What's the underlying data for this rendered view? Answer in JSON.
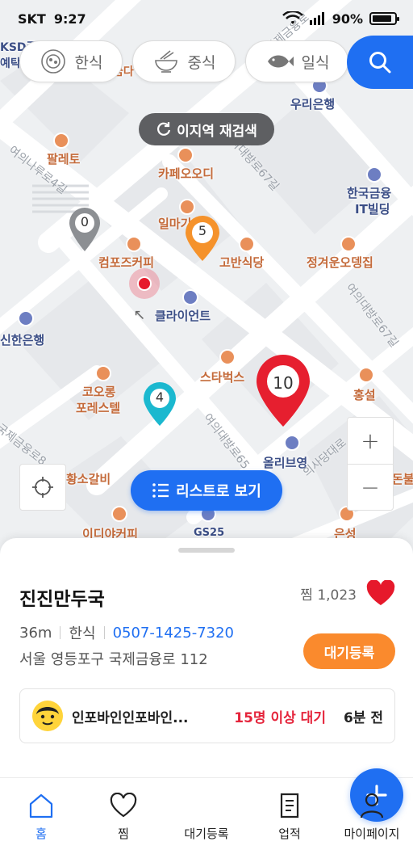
{
  "status_bar": {
    "carrier": "SKT",
    "time": "9:27",
    "battery": "90%",
    "battery_level": 0.9
  },
  "categories": [
    {
      "label": "한식",
      "icon": "bibimbap-icon"
    },
    {
      "label": "중식",
      "icon": "noodle-bowl-icon"
    },
    {
      "label": "일식",
      "icon": "fish-icon"
    }
  ],
  "map": {
    "research_label": "이지역 재검색",
    "list_view_label": "리스트로 보기",
    "poi": {
      "woori": "우리은행",
      "palleto": "팔레토",
      "kapeodi": "카페오오디",
      "korea_finance": "한국금융",
      "korea_finance_2": "IT빌딩",
      "ilmagi": "일마기",
      "compose": "컴포즈커피",
      "gobansikdang": "고반식당",
      "jeonggyeok": "정겨운오뎅집",
      "client": "클라이언트",
      "shinhan": "신한은행",
      "starbucks": "스타벅스",
      "coorong": "코오롱",
      "coorong_2": "포레스텔",
      "hongseol": "홍설",
      "oliveyoung": "올리브영",
      "galbi": "황소갈비",
      "ediya": "이디야커피",
      "gs25": "GS25",
      "eunseong": "은성",
      "donbul": "돈불",
      "ksd": "KSD증권",
      "ksd_2": "예탁",
      "geumda": "금다",
      "road1": "여의나루로4길",
      "road2": "여의대방로67길",
      "road3": "여의대방로67길",
      "road4": "여의대방로65",
      "road5": "국제금융로",
      "road6": "의사당대로",
      "road7": "국제금융로8"
    },
    "pins": [
      {
        "count": "0",
        "color": "#8c8f93"
      },
      {
        "count": "5",
        "color": "#f5922b"
      },
      {
        "count": "4",
        "color": "#1bb8cf"
      },
      {
        "count": "10",
        "color": "#e61f2f"
      }
    ]
  },
  "store": {
    "name": "진진만두국",
    "favorite_label": "찜 1,023",
    "distance": "36m",
    "category": "한식",
    "phone": "0507-1425-7320",
    "address": "서울 영등포구 국제금융로 112",
    "wait_button": "대기등록"
  },
  "activity": {
    "user": "인포바인인포바인...",
    "status": "15명 이상 대기",
    "time": "6분 전"
  },
  "tabs": [
    {
      "label": "홈",
      "active": true
    },
    {
      "label": "찜"
    },
    {
      "label": "대기등록"
    },
    {
      "label": "업적"
    },
    {
      "label": "마이페이지"
    }
  ],
  "colors": {
    "accent": "#1f6ff2",
    "wait": "#fa8a2d",
    "alert": "#e5243b"
  }
}
